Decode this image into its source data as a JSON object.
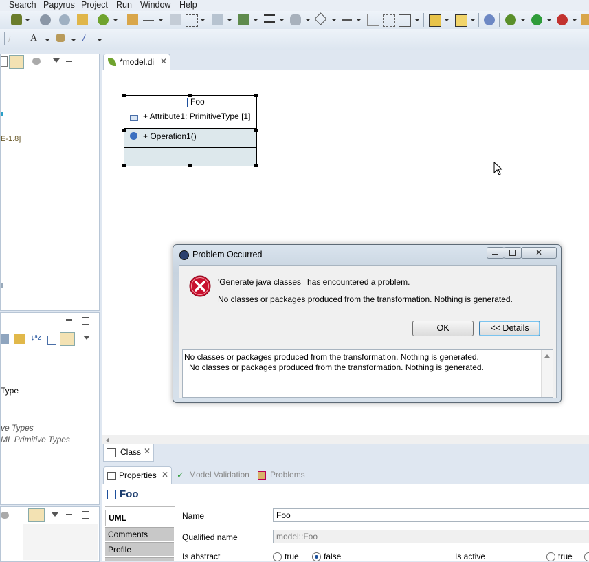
{
  "menu": [
    "Search",
    "Papyrus",
    "Project",
    "Run",
    "Window",
    "Help"
  ],
  "left_panel": {
    "top_fragments": [
      "E-1.8]"
    ],
    "mid_fragments": [
      "Type",
      "ve Types",
      "ML Primitive Types"
    ]
  },
  "editor": {
    "tab_label": "*model.di",
    "class_tab_label": "Class"
  },
  "diagram": {
    "class_name": "Foo",
    "attribute": "+ Attribute1: PrimitiveType [1]",
    "operation": "+ Operation1()"
  },
  "dialog": {
    "title": "Problem Occurred",
    "message1": "'Generate java classes ' has encountered a problem.",
    "message2": "No classes or packages produced from the transformation. Nothing is generated.",
    "ok_label": "OK",
    "details_label": "<< Details",
    "details_line1": "No classes or packages produced from the transformation. Nothing is generated.",
    "details_line2": "No classes or packages produced from the transformation. Nothing is generated."
  },
  "properties": {
    "tabs": [
      "Properties",
      "Model Validation",
      "Problems"
    ],
    "title": "Foo",
    "side_tabs": [
      "UML",
      "Comments",
      "Profile"
    ],
    "name_label": "Name",
    "name_value": "Foo",
    "qualified_label": "Qualified name",
    "qualified_value": "model::Foo",
    "abstract_label": "Is abstract",
    "true_label": "true",
    "false_label": "false",
    "active_label": "Is active",
    "active_true_label": "true"
  }
}
